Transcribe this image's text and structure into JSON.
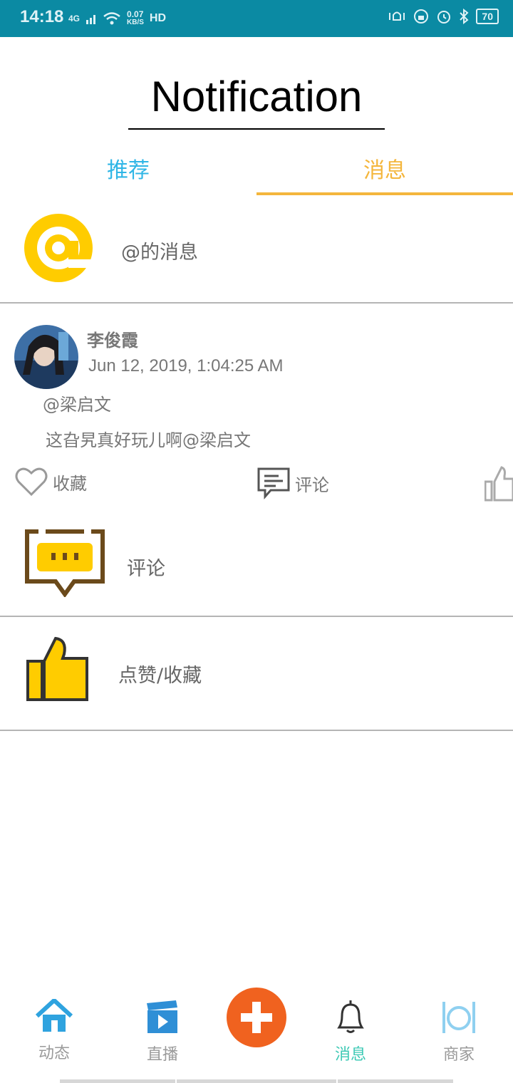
{
  "status_bar": {
    "time": "14:18",
    "network": "4G",
    "speed_value": "0.07",
    "speed_unit": "KB/S",
    "hd": "HD",
    "battery": "70"
  },
  "header": {
    "title": "Notification"
  },
  "tabs": [
    {
      "label": "推荐",
      "active": false
    },
    {
      "label": "消息",
      "active": true
    }
  ],
  "at_row": {
    "label": "@的消息"
  },
  "post": {
    "author": "李俊霞",
    "time": "Jun 12, 2019, 1:04:25 AM",
    "mention": "@梁启文",
    "content": "这旮旯真好玩儿啊@梁启文",
    "actions": {
      "favorite": "收藏",
      "comment": "评论"
    }
  },
  "comment_row": {
    "label": "评论"
  },
  "like_row": {
    "label": "点赞/收藏"
  },
  "bottom_nav": [
    {
      "label": "动态",
      "icon": "home-icon"
    },
    {
      "label": "直播",
      "icon": "video-icon"
    },
    {
      "label": "",
      "icon": "plus-icon"
    },
    {
      "label": "消息",
      "icon": "bell-icon",
      "active": true
    },
    {
      "label": "商家",
      "icon": "dining-icon"
    }
  ],
  "colors": {
    "status_bar": "#0b8aa3",
    "tab_recommend": "#2fb6e6",
    "tab_active": "#f4b63c",
    "nav_active": "#3dc9b5",
    "fab": "#f0621f",
    "icon_yellow": "#ffcc00"
  }
}
